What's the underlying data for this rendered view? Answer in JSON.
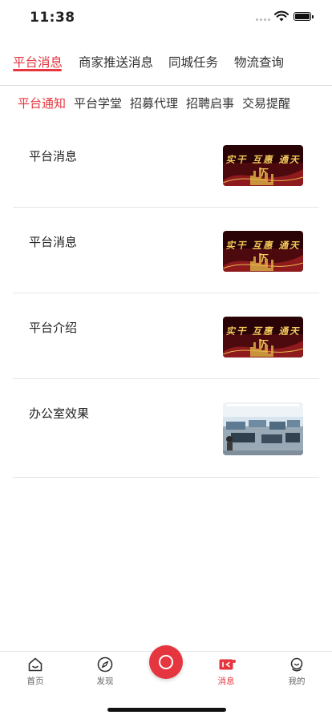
{
  "status": {
    "time": "11:38"
  },
  "top_tabs": [
    {
      "label": "平台消息",
      "active": true
    },
    {
      "label": "商家推送消息",
      "active": false
    },
    {
      "label": "同城任务",
      "active": false
    },
    {
      "label": "物流查询",
      "active": false
    }
  ],
  "sub_tabs": [
    {
      "label": "平台通知",
      "active": true
    },
    {
      "label": "平台学堂",
      "active": false
    },
    {
      "label": "招募代理",
      "active": false
    },
    {
      "label": "招聘启事",
      "active": false
    },
    {
      "label": "交易提醒",
      "active": false
    }
  ],
  "list": [
    {
      "title": "平台消息",
      "thumb": "banner",
      "thumb_text": "实干 互惠 通天下"
    },
    {
      "title": "平台消息",
      "thumb": "banner",
      "thumb_text": "实干 互惠 通天下"
    },
    {
      "title": "平台介绍",
      "thumb": "banner",
      "thumb_text": "实干 互惠 通天下"
    },
    {
      "title": "办公室效果",
      "thumb": "office-photo"
    }
  ],
  "tabbar": [
    {
      "label": "首页",
      "icon": "home-icon",
      "active": false
    },
    {
      "label": "发现",
      "icon": "compass-icon",
      "active": false
    },
    {
      "label": "",
      "icon": "center-record-icon",
      "active": false
    },
    {
      "label": "消息",
      "icon": "message-icon",
      "active": true
    },
    {
      "label": "我的",
      "icon": "profile-icon",
      "active": false
    }
  ],
  "colors": {
    "accent": "#e5363f",
    "divider": "#e6e6e6",
    "text": "#222222"
  }
}
